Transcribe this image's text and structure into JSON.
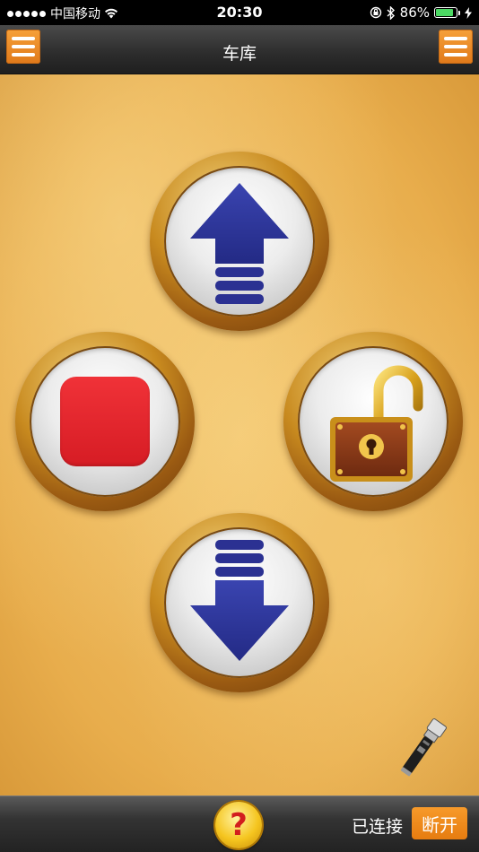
{
  "status_bar": {
    "carrier": "中国移动",
    "time": "20:30",
    "battery": "86%",
    "battery_level": 0.86
  },
  "nav": {
    "title": "车库"
  },
  "controls": {
    "up": "arrow-up-icon",
    "stop": "stop-square-icon",
    "unlock": "unlocked-padlock-icon",
    "down": "arrow-down-icon",
    "flashlight": "flashlight-icon"
  },
  "bottom_bar": {
    "help_label": "?",
    "connection_status": "已连接",
    "disconnect_label": "断开"
  },
  "colors": {
    "accent": "#e8821a",
    "arrow": "#2b3192",
    "stop": "#e3242b"
  }
}
